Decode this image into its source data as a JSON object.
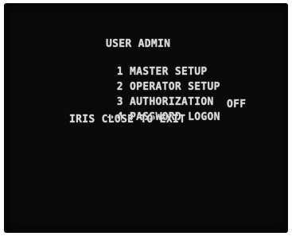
{
  "menu": {
    "title": "USER ADMIN",
    "items": [
      {
        "label": "1 MASTER SETUP"
      },
      {
        "label": "2 OPERATOR SETUP"
      },
      {
        "label": "3 AUTHORIZATION"
      },
      {
        "label": "4 PASSWORD LOGON",
        "value": "OFF",
        "cursor": "→"
      }
    ],
    "exit_hint": "IRIS CLOSE TO EXIT"
  },
  "colors": {
    "background": "#0a0a0a",
    "text": "#d8d8d8"
  }
}
